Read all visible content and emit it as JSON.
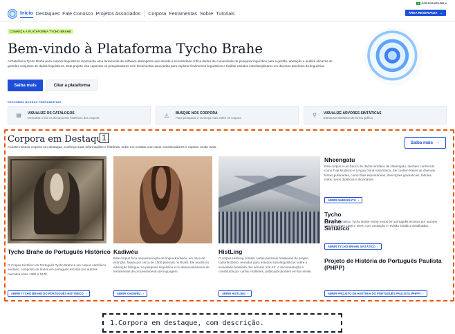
{
  "topbar": {
    "language": "PORTUGUÊS-BR",
    "language_chevron": "chevron-down-icon"
  },
  "nav": {
    "items": [
      "Início",
      "Destaques",
      "Fale Conosco",
      "Projetos Associados",
      "Corpora",
      "Ferramentas",
      "Sobre",
      "Tutoriais"
    ],
    "reserved_label": "ÁREA RESERVADA"
  },
  "hero": {
    "tag": "CONHEÇA A PLATAFORMA TYCHO BRAHE",
    "title": "Bem-vindo à Plataforma Tycho Brahe",
    "description": "A Plataforma Tycho Brahe para corpora linguísticos representa uma ferramenta de software abrangente que aborda a necessidade crítica dentro da comunidade de pesquisa linguística para a gestão, anotação e análise eficazes de grandes conjuntos de dados linguísticos. Este projeto visa capacitar os pesquisadores com ferramentas avançadas para explorar fenômenos linguísticos e facilitar estudos interdisciplinares em diversos domínios da linguística.",
    "primary_button": "Saiba mais",
    "secondary_button": "Citar a plataforma"
  },
  "tools": {
    "label": "DESCUBRA NOSSAS FERRAMENTAS",
    "items": [
      {
        "title": "VISUALIZE OS CATÁLOGOS",
        "desc": "Descubra e leia os documentos históricos dos corpora",
        "icon": "document-icon"
      },
      {
        "title": "BUSQUE NOS CORPORA",
        "desc": "Faça pesquisas e conheça mais sobre os corpora",
        "icon": "chart-icon"
      },
      {
        "title": "VISUALIZE ÁRVORES SINTÁTICAS",
        "desc": "Estruturas sintáticas de forma gráfica",
        "icon": "tree-icon"
      }
    ]
  },
  "featured": {
    "marker": "1",
    "title": "Corpora em Destaque",
    "description": "Acesse nossos corpora em destaque, conheça suas informações e histórias, entre em contato com seus coordenadores e explore muito mais.",
    "more_button": "Saiba mais",
    "cards": [
      {
        "title": "Tycho Brahe do Português Histórico",
        "desc": "O Corpus Histórico do Português Tycho Brahe é um corpus eletrônico anotado, composto de textos em português escritos por autores nascidos entre 1380 e 1978.",
        "link": "ABRIR TYCHO BRAHE DO PORTUGUÊS HISTÓRICO"
      },
      {
        "title": "Kadiwéu",
        "desc": "Este corpus foca na preservação da língua Kadiwéu, em risco de extinção, falada por cerca de 1000 pessoas no Brasil. Ele auxilia na educação bilíngue, na pesquisa linguística e no desenvolvimento de ferramentas de processamento de linguagem.",
        "link": "ABRIR KADIWÉU"
      },
      {
        "title": "HistLing",
        "desc": "O corpus HistLing contém cartas pessoais brasileiras do projeto Laborhistórico, reunidas para estudos sociolinguísticos sobre a sociedade brasileira dos séculos XIX-XX. A documentação é constituída por cartas e bilhetes, publicada também em fac-símile.",
        "link": "ABRIR HISTLING"
      }
    ],
    "side": [
      {
        "title": "Nheengatu",
        "desc": "Este corpus é um banco de dados sintático de Nheengatu, também conhecido como Tupi Moderno e Língua Geral Amazônica. Ele contém frases de diversas fontes publicadas, como falas espontâneas, descrições gramaticais, fábulas, mitos, livros didáticos e dicionários.",
        "link": "ABRIR NHEENGATU"
      },
      {
        "title": "Tycho Brahe Sintático",
        "desc": "O Corpus Sintático Tycho Brahe reúne textos em português escritos por autores nascidos entre 1380 e 1978, com anotação e revisão sintática detalhadas.",
        "link": "ABRIR TYCHO BRAHE SINTÁTICO"
      },
      {
        "title": "Projeto de História do Português Paulista (PHPP)",
        "desc": "",
        "link": "ABRIR PROJETO DE HISTÓRIA DO PORTUGUÊS PAULISTA (PHPP)"
      }
    ]
  },
  "caption": "1.Corpora em destaque, com descrição.",
  "colors": {
    "accent": "#1d4ed8",
    "highlight": "#ea580c",
    "tag_bg": "#d9f99d"
  }
}
